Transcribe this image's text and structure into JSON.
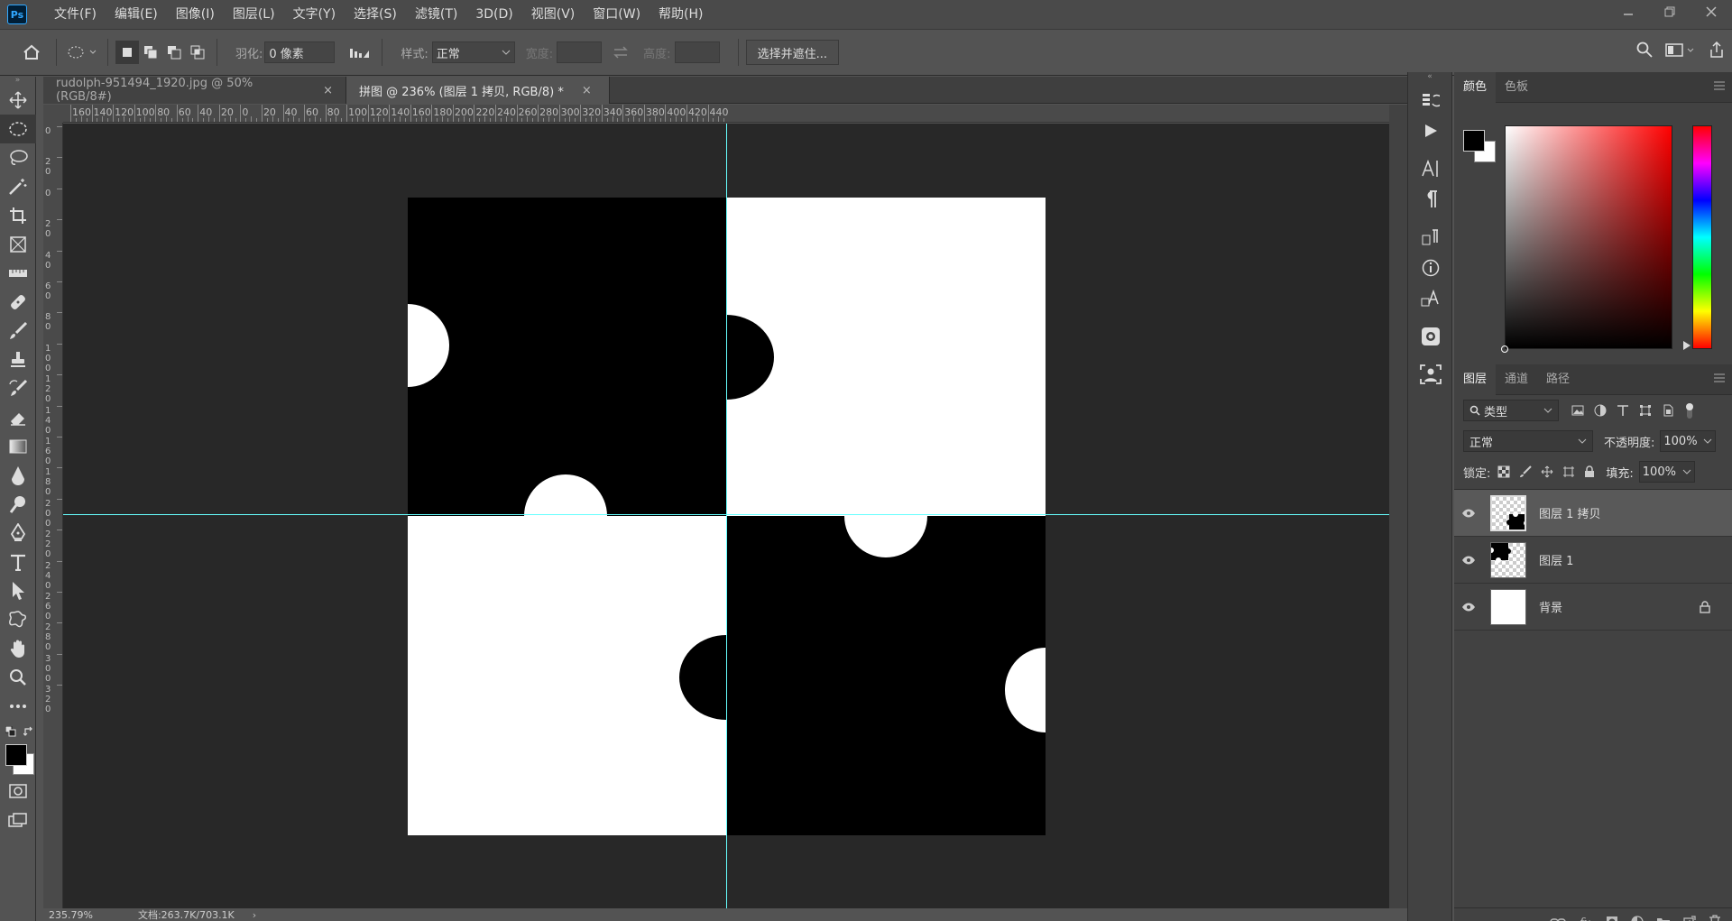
{
  "app": {
    "logo": "Ps"
  },
  "menu": [
    "文件(F)",
    "编辑(E)",
    "图像(I)",
    "图层(L)",
    "文字(Y)",
    "选择(S)",
    "滤镜(T)",
    "3D(D)",
    "视图(V)",
    "窗口(W)",
    "帮助(H)"
  ],
  "options": {
    "feather_label": "羽化:",
    "feather_value": "0 像素",
    "style_label": "样式:",
    "style_value": "正常",
    "width_label": "宽度:",
    "height_label": "高度:",
    "select_mask_button": "选择并遮住..."
  },
  "tabs": [
    {
      "label": "rudolph-951494_1920.jpg @ 50%(RGB/8#)",
      "close": "×"
    },
    {
      "label": "拼图 @ 236% (图层 1 拷贝, RGB/8) *",
      "close": "×"
    }
  ],
  "ruler_h": [
    "160",
    "140",
    "120",
    "100",
    "80",
    "60",
    "40",
    "20",
    "0",
    "20",
    "40",
    "60",
    "80",
    "100",
    "120",
    "140",
    "160",
    "180",
    "200",
    "220",
    "240",
    "260",
    "280",
    "300",
    "320",
    "340",
    "360",
    "380",
    "400",
    "420",
    "440"
  ],
  "ruler_v": [
    "0",
    "20",
    "0",
    "20",
    "40",
    "60",
    "80",
    "100",
    "120",
    "140",
    "160",
    "180",
    "200",
    "220",
    "240",
    "260",
    "280",
    "300",
    "320"
  ],
  "status": {
    "zoom": "235.79%",
    "doc": "文档:263.7K/703.1K"
  },
  "color_panel": {
    "tabs": [
      "颜色",
      "色板"
    ],
    "fg": "#000000",
    "bg": "#ffffff"
  },
  "layers_panel": {
    "tabs": [
      "图层",
      "通道",
      "路径"
    ],
    "filter_label": "类型",
    "blend_mode": "正常",
    "opacity_label": "不透明度:",
    "opacity_value": "100%",
    "lock_label": "锁定:",
    "fill_label": "填充:",
    "fill_value": "100%",
    "layers": [
      {
        "name": "图层 1 拷贝",
        "selected": true
      },
      {
        "name": "图层 1",
        "selected": false
      },
      {
        "name": "背景",
        "selected": false
      }
    ]
  }
}
